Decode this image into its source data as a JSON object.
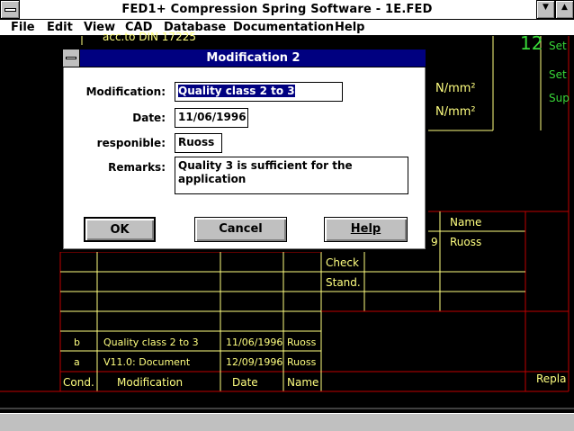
{
  "window": {
    "title": "FED1+  Compression Spring Software  -  1E.FED",
    "system_menu_icon": "system-menu-icon",
    "minimize_icon": "minimize-arrow-icon",
    "maximize_icon": "maximize-arrow-icon"
  },
  "menu": {
    "items": [
      {
        "label": "File"
      },
      {
        "label": "Edit"
      },
      {
        "label": "View"
      },
      {
        "label": "CAD"
      },
      {
        "label": "Database"
      },
      {
        "label": "Documentation"
      },
      {
        "label": "Help"
      }
    ]
  },
  "drawing": {
    "top_note": "acc.to DIN 17225",
    "unit_1": "N/mm²",
    "unit_2": "N/mm²",
    "big_number": "12",
    "side_labels": [
      "Set",
      "Set",
      "Sup"
    ],
    "header_name": "Name",
    "drawn_suffix": "9",
    "drawn_name": "Ruoss",
    "check_label": "Check",
    "stand_label": "Stand.",
    "revisions": [
      {
        "cond": "b",
        "modification": "Quality class 2 to 3",
        "date": "11/06/1996",
        "name": "Ruoss"
      },
      {
        "cond": "a",
        "modification": "V11.0: Document",
        "date": "12/09/1996",
        "name": "Ruoss"
      }
    ],
    "footer": {
      "cond": "Cond.",
      "modification": "Modification",
      "date": "Date",
      "name": "Name",
      "replace": "Repla"
    },
    "colors": {
      "red_lines": "#c00000",
      "yellow_lines": "#ffff80",
      "green_text": "#38d838"
    }
  },
  "dialog": {
    "title": "Modification 2",
    "fields": {
      "modification_label": "Modification:",
      "modification_value": "Quality class 2 to 3",
      "date_label": "Date:",
      "date_value": "11/06/1996",
      "responsible_label": "responible:",
      "responsible_value": "Ruoss",
      "remarks_label": "Remarks:",
      "remarks_value": "Quality 3 is sufficient for the application"
    },
    "buttons": {
      "ok": "OK",
      "cancel": "Cancel",
      "help": "Help"
    }
  }
}
